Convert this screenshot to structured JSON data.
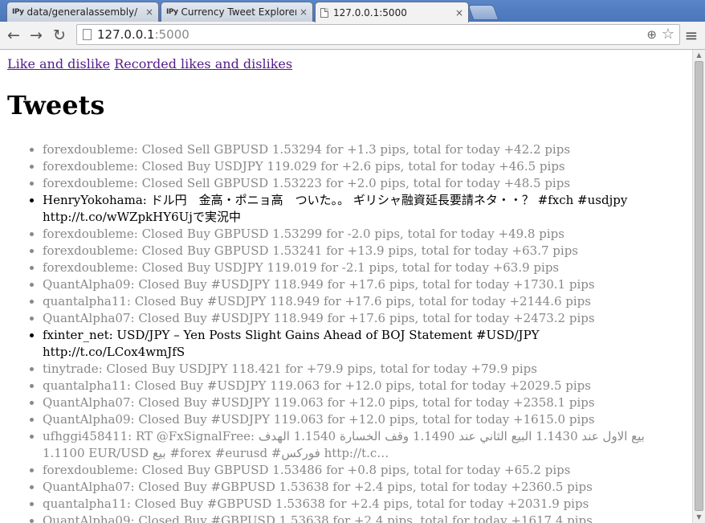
{
  "browser": {
    "tabs": [
      {
        "favicon": "IPy",
        "title": "data/generalassembly/",
        "close": "×"
      },
      {
        "favicon": "IPy",
        "title": "Currency Tweet Explorer",
        "close": "×"
      },
      {
        "favicon": "page-icon",
        "title": "127.0.0.1:5000",
        "close": "×"
      }
    ],
    "nav": {
      "back": "←",
      "forward": "→",
      "reload": "↻"
    },
    "address": {
      "host": "127.0.0.1",
      "port": ":5000"
    },
    "icons": {
      "zoom": "⊕",
      "star": "☆",
      "menu": "≡"
    }
  },
  "page": {
    "links": [
      {
        "label": "Like and dislike"
      },
      {
        "label": "Recorded likes and dislikes"
      }
    ],
    "title": "Tweets",
    "tweets": [
      {
        "text": "forexdoubleme: Closed Sell GBPUSD 1.53294 for +1.3 pips, total for today +42.2 pips",
        "highlight": false
      },
      {
        "text": "forexdoubleme: Closed Buy USDJPY 119.029 for +2.6 pips, total for today +46.5 pips",
        "highlight": false
      },
      {
        "text": "forexdoubleme: Closed Sell GBPUSD 1.53223 for +2.0 pips, total for today +48.5 pips",
        "highlight": false
      },
      {
        "text": "HenryYokohama: ドル円　金高・ポニョ高　ついた。。 ギリシャ融資延長要請ネタ・・？ #fxch #usdjpy http://t.co/wWZpkHY6Ujで実況中",
        "highlight": true
      },
      {
        "text": "forexdoubleme: Closed Buy GBPUSD 1.53299 for -2.0 pips, total for today +49.8 pips",
        "highlight": false
      },
      {
        "text": "forexdoubleme: Closed Buy GBPUSD 1.53241 for +13.9 pips, total for today +63.7 pips",
        "highlight": false
      },
      {
        "text": "forexdoubleme: Closed Buy USDJPY 119.019 for -2.1 pips, total for today +63.9 pips",
        "highlight": false
      },
      {
        "text": "QuantAlpha09: Closed Buy #USDJPY 118.949 for +17.6 pips, total for today +1730.1 pips",
        "highlight": false
      },
      {
        "text": "quantalpha11: Closed Buy #USDJPY 118.949 for +17.6 pips, total for today +2144.6 pips",
        "highlight": false
      },
      {
        "text": "QuantAlpha07: Closed Buy #USDJPY 118.949 for +17.6 pips, total for today +2473.2 pips",
        "highlight": false
      },
      {
        "text": "fxinter_net: USD/JPY – Yen Posts Slight Gains Ahead of BOJ Statement #USD/JPY http://t.co/LCox4wmJfS",
        "highlight": true
      },
      {
        "text": "tinytrade: Closed Buy USDJPY 118.421 for +79.9 pips, total for today +79.9 pips",
        "highlight": false
      },
      {
        "text": "quantalpha11: Closed Buy #USDJPY 119.063 for +12.0 pips, total for today +2029.5 pips",
        "highlight": false
      },
      {
        "text": "QuantAlpha07: Closed Buy #USDJPY 119.063 for +12.0 pips, total for today +2358.1 pips",
        "highlight": false
      },
      {
        "text": "QuantAlpha09: Closed Buy #USDJPY 119.063 for +12.0 pips, total for today +1615.0 pips",
        "highlight": false
      },
      {
        "text": "ufhggi458411: RT @FxSignalFree: بيع الاول عند 1.1430 البيع الثاني عند 1.1490 وقف الخسارة 1.1540 الهدف 1.1100 EUR/USD بيع #forex #eurusd #فوركس http://t.c…",
        "highlight": false
      },
      {
        "text": "forexdoubleme: Closed Buy GBPUSD 1.53486 for +0.8 pips, total for today +65.2 pips",
        "highlight": false
      },
      {
        "text": "QuantAlpha07: Closed Buy #GBPUSD 1.53638 for +2.4 pips, total for today +2360.5 pips",
        "highlight": false
      },
      {
        "text": "quantalpha11: Closed Buy #GBPUSD 1.53638 for +2.4 pips, total for today +2031.9 pips",
        "highlight": false
      },
      {
        "text": "QuantAlpha09: Closed Buy #GBPUSD 1.53638 for +2.4 pips, total for today +1617.4 pips",
        "highlight": false
      }
    ]
  },
  "colors": {
    "link": "#551a8b",
    "tweet_normal": "#888888",
    "tweet_highlight": "#000000",
    "tabstrip": "#4a76ba"
  }
}
